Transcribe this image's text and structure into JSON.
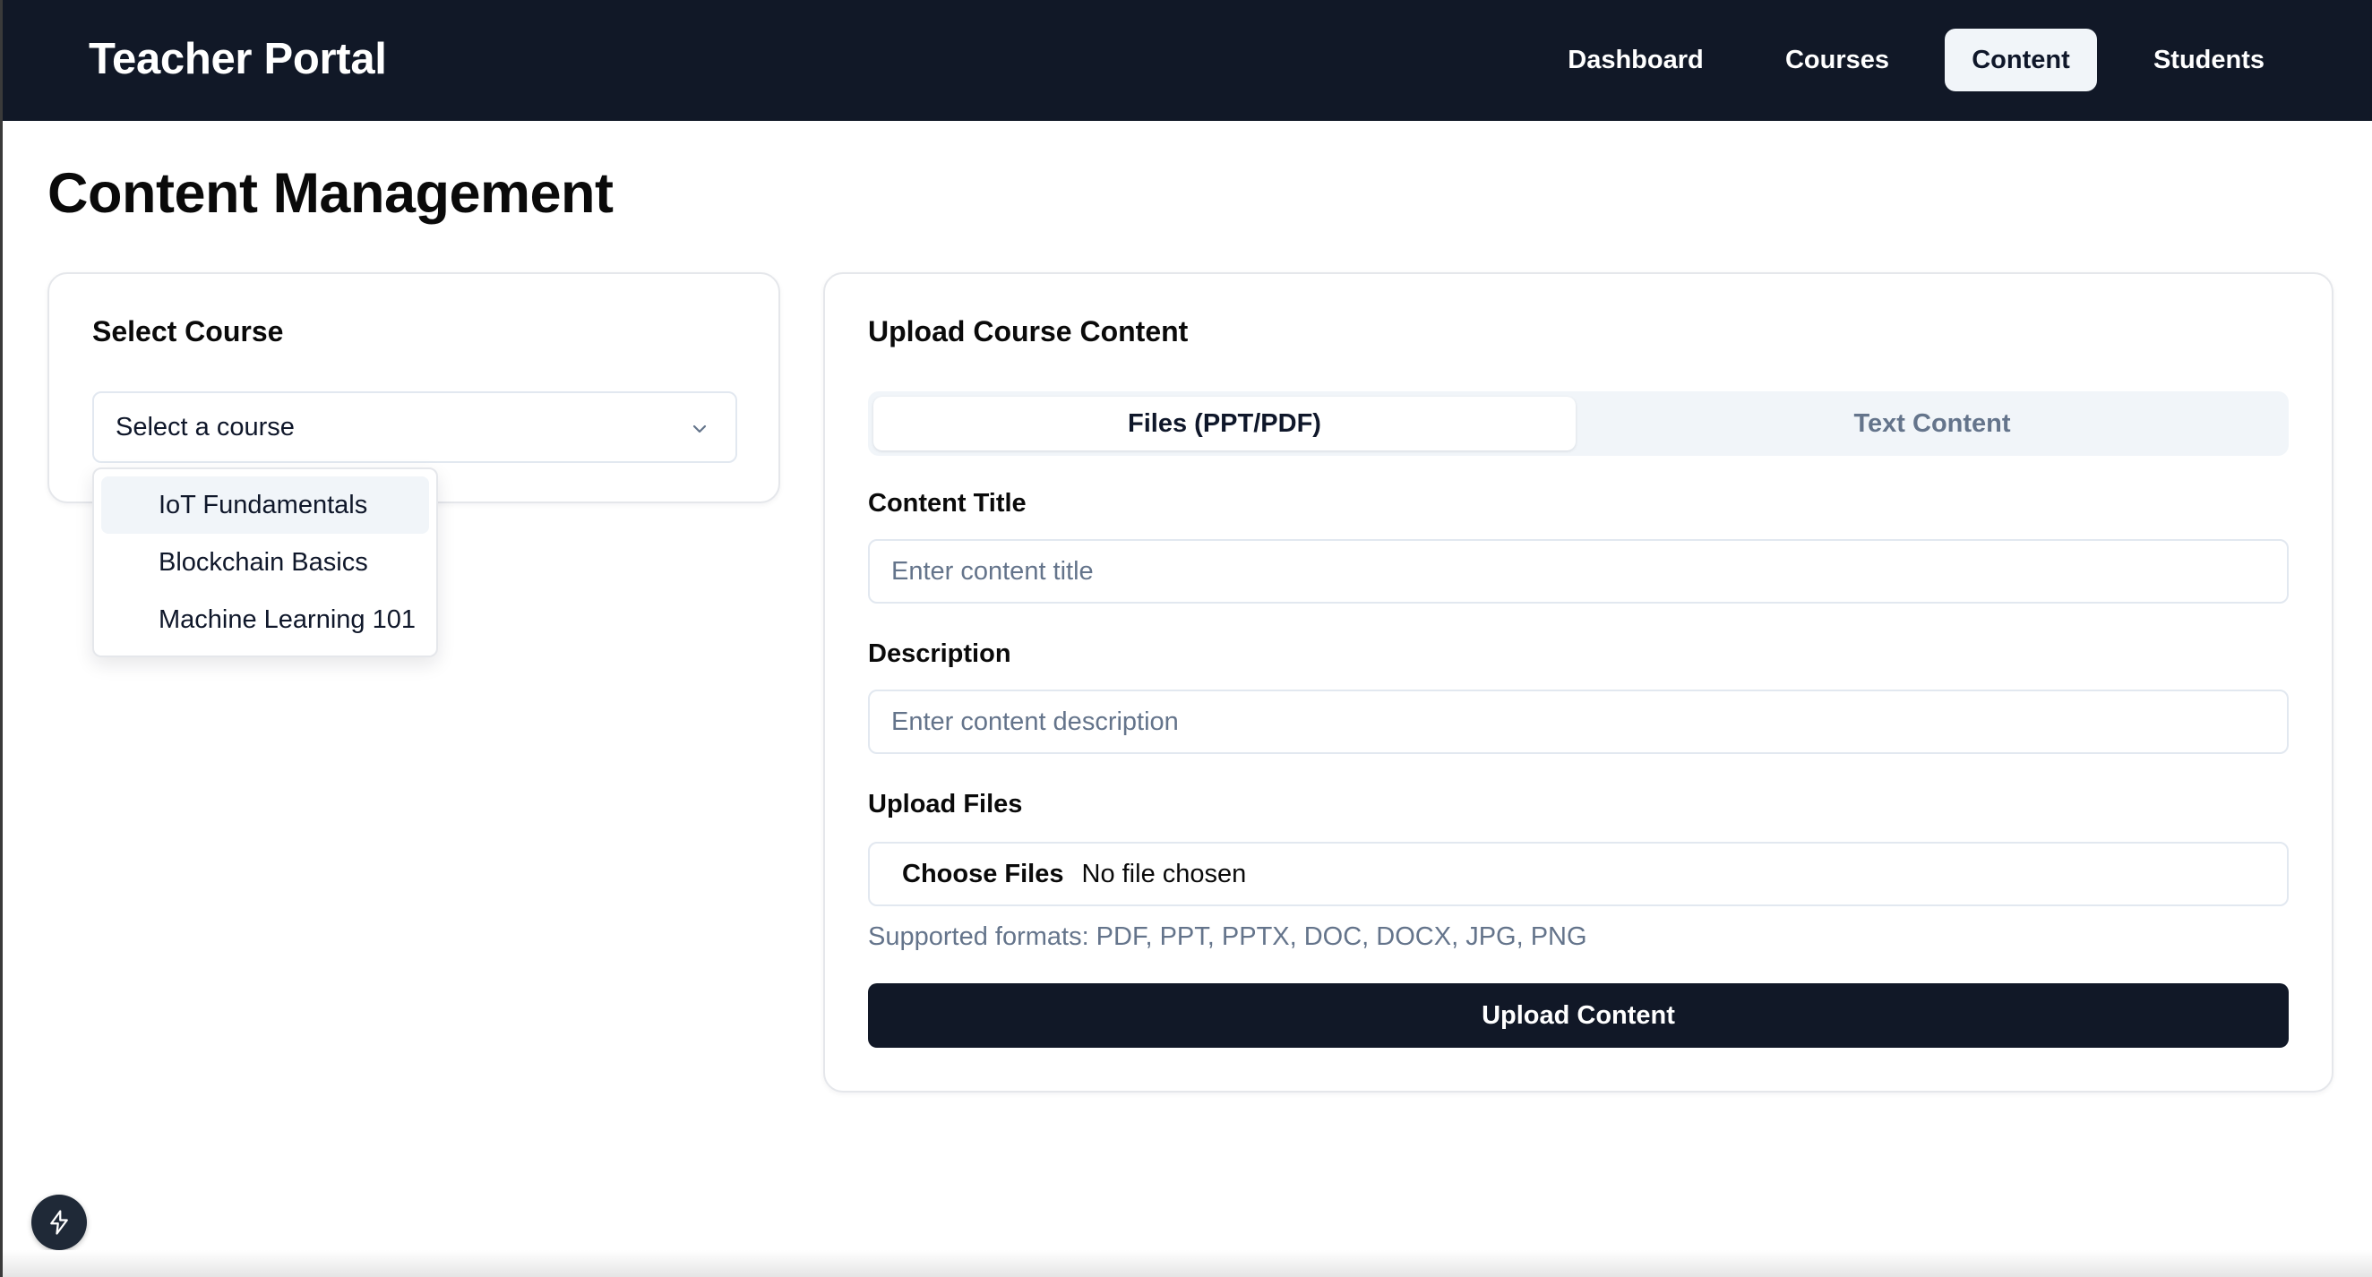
{
  "header": {
    "brand": "Teacher Portal",
    "nav": [
      {
        "label": "Dashboard",
        "active": false
      },
      {
        "label": "Courses",
        "active": false
      },
      {
        "label": "Content",
        "active": true
      },
      {
        "label": "Students",
        "active": false
      }
    ]
  },
  "page": {
    "title": "Content Management"
  },
  "select_course": {
    "title": "Select Course",
    "select_value": "Select a course",
    "options": [
      "IoT Fundamentals",
      "Blockchain Basics",
      "Machine Learning 101"
    ],
    "highlighted_option": "IoT Fundamentals"
  },
  "upload": {
    "title": "Upload Course Content",
    "tabs": [
      {
        "label": "Files (PPT/PDF)",
        "active": true
      },
      {
        "label": "Text Content",
        "active": false
      }
    ],
    "content_title_label": "Content Title",
    "content_title_placeholder": "Enter content title",
    "description_label": "Description",
    "description_placeholder": "Enter content description",
    "files_label": "Upload Files",
    "choose_files_label": "Choose Files",
    "file_status": "No file chosen",
    "hint": "Supported formats: PDF, PPT, PPTX, DOC, DOCX, JPG, PNG",
    "submit_label": "Upload Content"
  },
  "icons": {
    "chevron": "chevron-down-icon",
    "badge": "lightning-bolt-icon"
  },
  "colors": {
    "header_bg": "#111827",
    "primary_button": "#111827",
    "active_nav_bg": "#f1f5f9",
    "muted_text": "#64748b"
  }
}
